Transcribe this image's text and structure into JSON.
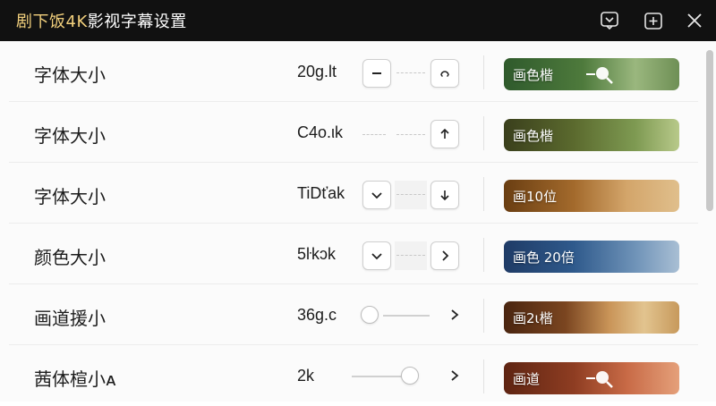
{
  "window": {
    "title_brand": "剧下饭4K",
    "title_rest": "影视字幕设置",
    "buttons": [
      "feedback-icon",
      "add-icon",
      "close-icon"
    ]
  },
  "rows": [
    {
      "label": "字体大小",
      "value": "20g.lt",
      "control": "stepper",
      "left_icon": "minus-icon",
      "right_icon": "rotate-icon",
      "preview": "画色楷"
    },
    {
      "label": "字体大小",
      "value": "C4o.ιk",
      "control": "stepper-plain",
      "left_icon": "",
      "right_icon": "arrow-up-icon",
      "preview": "画色楷"
    },
    {
      "label": "字体大小",
      "value": "TiDťak",
      "control": "stepper",
      "left_icon": "chevron-down-icon",
      "right_icon": "arrow-down-icon",
      "preview": "画10位"
    },
    {
      "label": "颜色大小",
      "value": "5ŀkɔk",
      "control": "stepper",
      "left_icon": "chevron-down-icon",
      "right_icon": "chevron-right-icon",
      "preview": "画色 20倍"
    },
    {
      "label": "画道援小",
      "value": "36g.c",
      "control": "slider-left",
      "preview": "画2ι楷"
    },
    {
      "label": "茜体楦小ᴀ",
      "value": "2k",
      "control": "slider-right",
      "preview": "画道"
    }
  ],
  "colors": {
    "titlebar_bg": "#111111",
    "brand": "#f1cf7c",
    "preview_green": "#3f6b3a",
    "preview_olive": "#4a5326",
    "preview_amber": "#8a5a24",
    "preview_blue": "#2b4f7e",
    "preview_brown": "#5a3318",
    "preview_red": "#7a3320"
  }
}
